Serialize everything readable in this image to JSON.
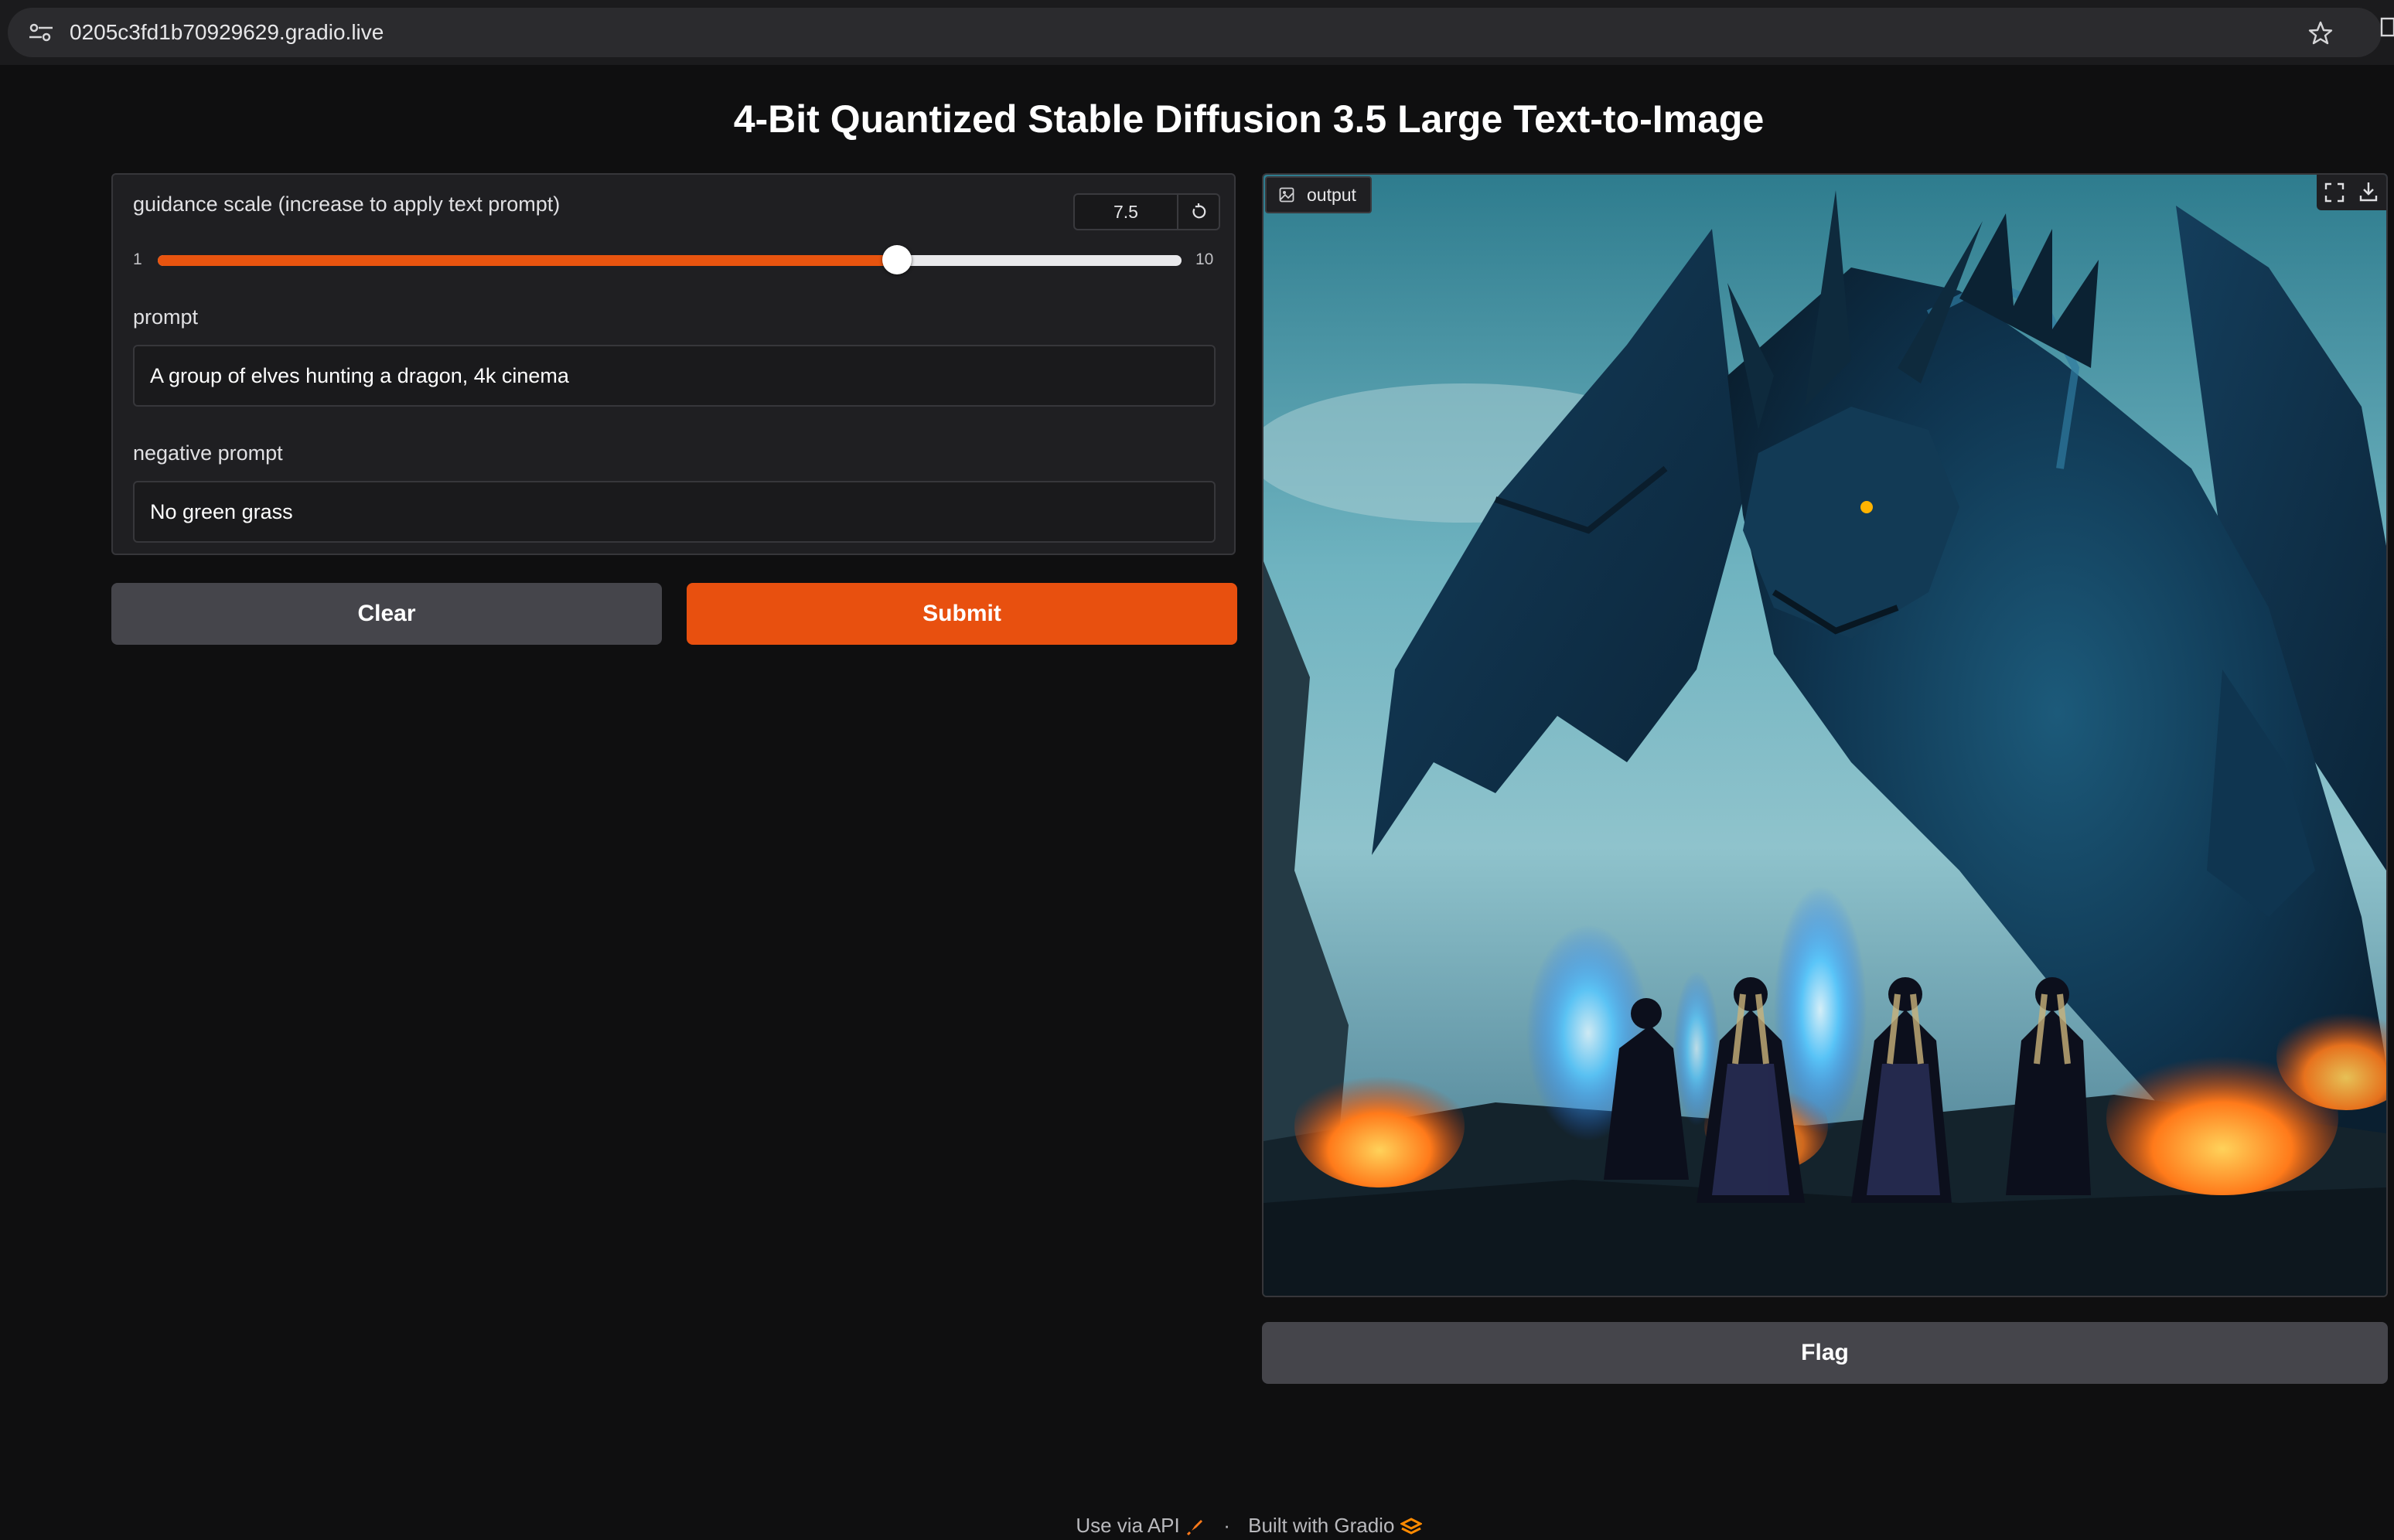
{
  "browser": {
    "url": "0205c3fd1b70929629.gradio.live"
  },
  "app": {
    "title": "4-Bit Quantized Stable Diffusion 3.5 Large Text-to-Image"
  },
  "guidance": {
    "label": "guidance scale (increase to apply text prompt)",
    "value": "7.5",
    "min_label": "1",
    "max_label": "10",
    "min": 1,
    "max": 10,
    "current": 7.5
  },
  "prompt": {
    "label": "prompt",
    "value": "A group of elves hunting a dragon, 4k cinema"
  },
  "negative_prompt": {
    "label": "negative prompt",
    "value": "No green grass"
  },
  "buttons": {
    "clear": "Clear",
    "submit": "Submit",
    "flag": "Flag"
  },
  "output": {
    "label": "output"
  },
  "footer": {
    "api": "Use via API",
    "separator": "·",
    "built": "Built with Gradio"
  },
  "colors": {
    "accent": "#e8500f",
    "background": "#0f0f10",
    "panel": "#1f1f22",
    "secondary_button": "#45454b"
  },
  "icons": [
    "site-settings-icon",
    "star-icon",
    "reset-icon",
    "image-icon",
    "fullscreen-icon",
    "download-icon",
    "rocket-icon",
    "gradio-logo-icon"
  ]
}
